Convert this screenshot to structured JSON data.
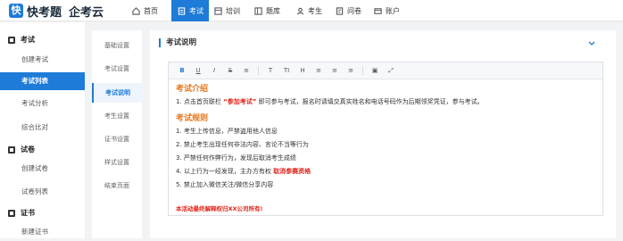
{
  "brand": {
    "name": "快考题",
    "org": "企考云",
    "logo_letter": "快",
    "accent": "#1e7bd7"
  },
  "nav": [
    {
      "label": "首页",
      "icon": "home-icon"
    },
    {
      "label": "考试",
      "icon": "exam-icon"
    },
    {
      "label": "培训",
      "icon": "training-icon"
    },
    {
      "label": "题库",
      "icon": "question-bank-icon"
    },
    {
      "label": "考生",
      "icon": "user-icon"
    },
    {
      "label": "问卷",
      "icon": "survey-icon"
    },
    {
      "label": "账户",
      "icon": "account-icon"
    }
  ],
  "sidebar": {
    "group1": "考试",
    "items1": [
      "创建考试",
      "考试列表",
      "考试分析",
      "综合比对"
    ],
    "group2": "试卷",
    "items2": [
      "创建试卷",
      "试卷列表"
    ],
    "group3": "证书",
    "items3": [
      "新建证书"
    ]
  },
  "subnav": [
    "基础设置",
    "考试设置",
    "考试说明",
    "考生设置",
    "证书设置",
    "样式设置",
    "结束页面"
  ],
  "panel": {
    "title": "考试说明"
  },
  "toolbar": [
    "B",
    "U",
    "I",
    "S",
    "≡",
    "T",
    "TI",
    "H",
    "≡",
    "≡",
    "≡",
    "▣",
    "⤢"
  ],
  "content": {
    "h1": "考试介绍",
    "p1_pre": "1. 点击首页联栏",
    "p1_quote": "“参加考试”",
    "p1_post": "即可参与考试，报名时请填交真实姓名和电话号码作为后期领奖凭证，参与考试。",
    "h2": "考试规则",
    "rules": [
      "1. 考生上传信息，严禁盗用他人信息",
      "2. 禁止考生出现任何非法内容、言论不当等行为",
      "3. 严禁任何作弊行为，发现后取消考生成绩"
    ],
    "rule4_pre": "4. 以上行为一经发现，主办方有权",
    "rule4_red": "取消参赛资格",
    "rule5": "5. 禁止加入微信关注/微信分享内容",
    "footer": "本活动最终解释权归XX公司所有!"
  }
}
